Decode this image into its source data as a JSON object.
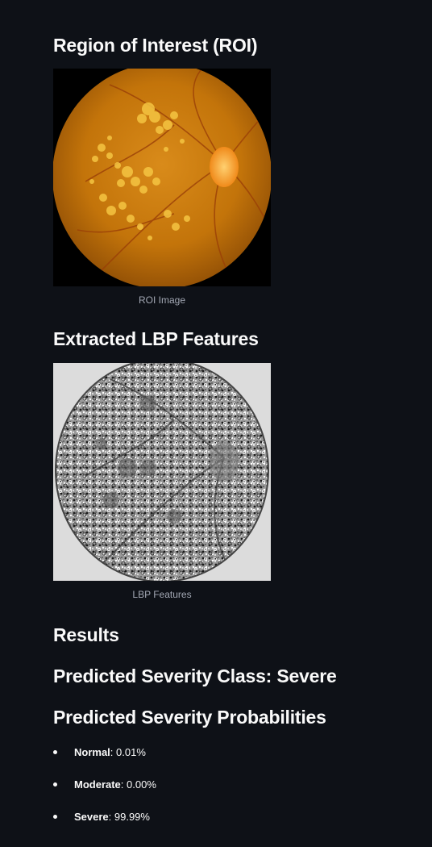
{
  "roi": {
    "heading": "Region of Interest (ROI)",
    "caption": "ROI Image"
  },
  "lbp": {
    "heading": "Extracted LBP Features",
    "caption": "LBP Features"
  },
  "results": {
    "heading": "Results",
    "predicted_class": "Predicted Severity Class: Severe",
    "probabilities_heading": "Predicted Severity Probabilities",
    "probabilities": [
      {
        "label": "Normal",
        "value": ": 0.01%"
      },
      {
        "label": "Moderate",
        "value": ": 0.00%"
      },
      {
        "label": "Severe",
        "value": ": 99.99%"
      }
    ]
  },
  "colors": {
    "background": "#0e1117",
    "text": "#fafafa",
    "caption": "#a3a8b4",
    "fundus": "#c97a0a"
  }
}
